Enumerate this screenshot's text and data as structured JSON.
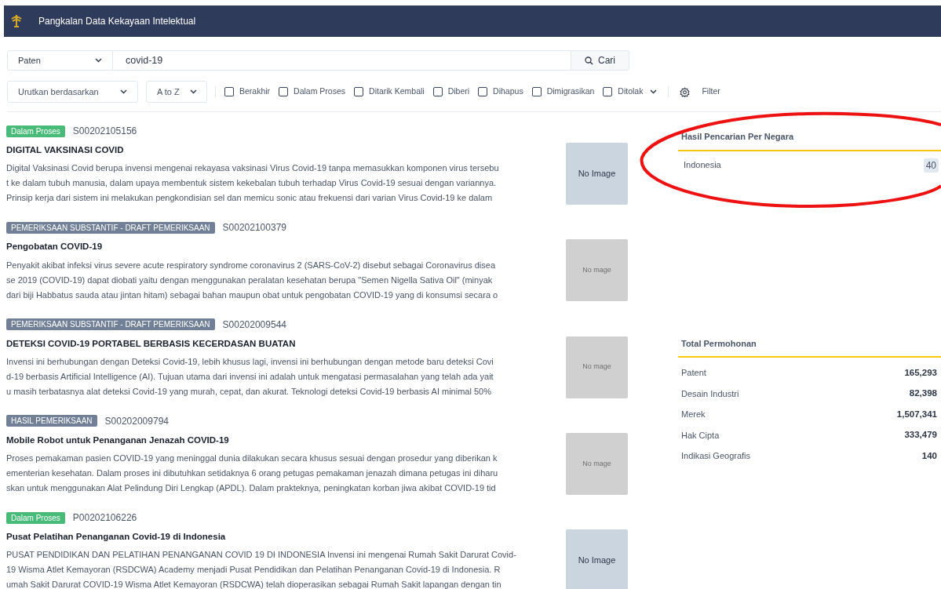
{
  "header": {
    "title": "Pangkalan Data Kekayaan Intelektual"
  },
  "search": {
    "type": "Paten",
    "query": "covid-19",
    "button": "Cari"
  },
  "filters": {
    "sort": "Urutkan berdasarkan",
    "order": "A to Z",
    "statuses": [
      {
        "label": "Berakhir",
        "checked": false
      },
      {
        "label": "Dalam Proses",
        "checked": false
      },
      {
        "label": "Ditarik Kembali",
        "checked": false
      },
      {
        "label": "Diberi",
        "checked": false
      },
      {
        "label": "Dihapus",
        "checked": false
      },
      {
        "label": "Dimigrasikan",
        "checked": false
      },
      {
        "label": "Ditolak",
        "checked": false
      }
    ],
    "filter_button": "Filter"
  },
  "results": [
    {
      "status": "Dalam Proses",
      "color": "#48bb78",
      "number": "S00202105156",
      "title": "DIGITAL VAKSINASI COVID",
      "lines": [
        "Digital Vaksinasi Covid berupa invensi mengenai rekayasa vaksinasi Virus Covid-19 tanpa memasukkan komponen virus tersebu",
        "t ke dalam tubuh manusia, dalam upaya membentuk sistem kekebalan tubuh terhadap Virus Covid-19 sesuai dengan variannya.",
        "Prinsip kerja dari sistem ini melakukan pengkondisian sel dan memicu sonic atau frekuensi dari varian Virus Covid-19 ke dalam"
      ],
      "image": {
        "kind": "placeholder",
        "text": "No Image"
      }
    },
    {
      "status": "PEMERIKSAAN SUBSTANTIF - DRAFT PEMERIKSAAN",
      "color": "#718096",
      "number": "S00202100379",
      "title": "Pengobatan COVID-19",
      "lines": [
        "Penyakit akibat infeksi virus severe acute respiratory syndrome coronavirus 2 (SARS-CoV-2) disebut sebagai Coronavirus disea",
        "se 2019 (COVID-19) dapat diobati yaitu dengan menggunakan peralatan kesehatan berupa \"Semen Nigella Sativa Oil\" (minyak",
        "dari biji Habbatus sauda atau jintan hitam) sebagai bahan maupun obat untuk pengobatan COVID-19 yang di konsumsi secara o"
      ],
      "image": {
        "kind": "broken",
        "text": "No mage"
      }
    },
    {
      "status": "PEMERIKSAAN SUBSTANTIF - DRAFT PEMERIKSAAN",
      "color": "#718096",
      "number": "S00202009544",
      "title": "DETEKSI COVID-19 PORTABEL BERBASIS KECERDASAN BUATAN",
      "lines": [
        "Invensi ini berhubungan dengan Deteksi Covid-19, lebih khusus lagi, invensi ini berhubungan dengan metode baru deteksi Covi",
        "d-19 berbasis Artificial Intelligence (AI). Tujuan utama dari invensi ini adalah untuk mengatasi permasalahan yang telah ada yait",
        "u masih terbatasnya alat deteksi Covid-19 yang murah, cepat, dan akurat. Teknologi deteksi Covid-19 berbasis AI minimal 50%"
      ],
      "image": {
        "kind": "broken",
        "text": "No mage"
      }
    },
    {
      "status": "HASIL PEMERIKSAAN",
      "color": "#718096",
      "number": "S00202009794",
      "title": "Mobile Robot untuk Penanganan Jenazah COVID-19",
      "lines": [
        "Proses pemakaman pasien COVID-19 yang meninggal dunia dilakukan secara khusus sesuai dengan prosedur yang diberikan k",
        "ementerian kesehatan. Dalam proses ini dibutuhkan setidaknya 6 orang petugas pemakaman jenazah dimana petugas ini diharu",
        "skan untuk menggunakan Alat Pelindung Diri Lengkap (APDL). Dalam prakteknya, peningkatan korban jiwa akibat COVID-19 tid"
      ],
      "image": {
        "kind": "broken",
        "text": "No mage"
      }
    },
    {
      "status": "Dalam Proses",
      "color": "#48bb78",
      "number": "P00202106226",
      "title": "Pusat Pelatihan Penanganan Covid-19 di Indonesia",
      "lines": [
        "PUSAT PENDIDIKAN DAN PELATIHAN PENANGANAN COVID 19 DI INDONESIA Invensi ini mengenai Rumah Sakit Darurat Covid-",
        "19 Wisma Atlet Kemayoran (RSDCWA) Academy menjadi Pusat Pendidikan dan Pelatihan Penanganan Covid-19 di Indonesia. R",
        "umah Sakit Darurat COVID-19 Wisma Atlet Kemayoran (RSDCWA) telah dioperasikan sebagai Rumah Sakit lapangan dengan tin"
      ],
      "image": {
        "kind": "placeholder",
        "text": "No Image"
      }
    }
  ],
  "by_country": {
    "title": "Hasil Pencarian Per Negara",
    "rows": [
      {
        "country": "Indonesia",
        "count": "40"
      }
    ]
  },
  "totals": {
    "title": "Total Permohonan",
    "rows": [
      {
        "label": "Patent",
        "value": "165,293"
      },
      {
        "label": "Desain Industri",
        "value": "82,398"
      },
      {
        "label": "Merek",
        "value": "1,507,341"
      },
      {
        "label": "Hak Cipta",
        "value": "333,479"
      },
      {
        "label": "Indikasi Geografis",
        "value": "140"
      }
    ]
  },
  "highlight": {
    "kind": "ellipse"
  }
}
